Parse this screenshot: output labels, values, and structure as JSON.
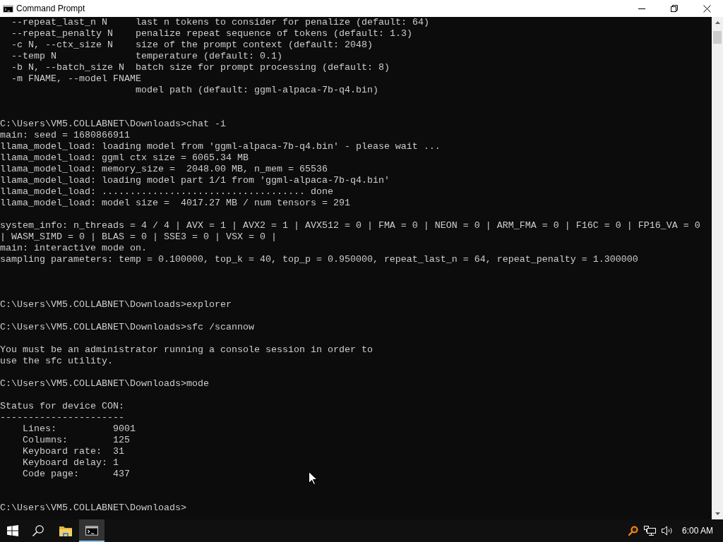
{
  "window": {
    "title": "Command Prompt"
  },
  "console": {
    "lines": [
      {
        "kind": "option",
        "flag": "--repeat_last_n N",
        "description": "last n tokens to consider for penalize (default: 64)"
      },
      {
        "kind": "option",
        "flag": "--repeat_penalty N",
        "description": "penalize repeat sequence of tokens (default: 1.3)"
      },
      {
        "kind": "option",
        "flag": "-c N, --ctx_size N",
        "description": "size of the prompt context (default: 2048)"
      },
      {
        "kind": "option",
        "flag": "--temp N",
        "description": "temperature (default: 0.1)"
      },
      {
        "kind": "option",
        "flag": "-b N, --batch_size N",
        "description": "batch size for prompt processing (default: 8)"
      },
      {
        "kind": "option",
        "flag": "-m FNAME, --model FNAME",
        "description": "model path (default: ggml-alpaca-7b-q4.bin)"
      },
      {
        "kind": "blank"
      },
      {
        "kind": "blank"
      },
      {
        "kind": "text",
        "text": "C:\\Users\\VM5.COLLABNET\\Downloads>chat -i"
      },
      {
        "kind": "text",
        "text": "main: seed = 1680866911"
      },
      {
        "kind": "text",
        "text": "llama_model_load: loading model from 'ggml-alpaca-7b-q4.bin' - please wait ..."
      },
      {
        "kind": "text",
        "text": "llama_model_load: ggml ctx size = 6065.34 MB"
      },
      {
        "kind": "text",
        "text": "llama_model_load: memory_size =  2048.00 MB, n_mem = 65536"
      },
      {
        "kind": "text",
        "text": "llama_model_load: loading model part 1/1 from 'ggml-alpaca-7b-q4.bin'"
      },
      {
        "kind": "text",
        "text": "llama_model_load: .................................... done"
      },
      {
        "kind": "text",
        "text": "llama_model_load: model size =  4017.27 MB / num tensors = 291"
      },
      {
        "kind": "blank"
      },
      {
        "kind": "text",
        "text": "system_info: n_threads = 4 / 4 | AVX = 1 | AVX2 = 1 | AVX512 = 0 | FMA = 0 | NEON = 0 | ARM_FMA = 0 | F16C = 0 | FP16_VA = 0"
      },
      {
        "kind": "text",
        "text": "| WASM_SIMD = 0 | BLAS = 0 | SSE3 = 0 | VSX = 0 |"
      },
      {
        "kind": "text",
        "text": "main: interactive mode on."
      },
      {
        "kind": "text",
        "text": "sampling parameters: temp = 0.100000, top_k = 40, top_p = 0.950000, repeat_last_n = 64, repeat_penalty = 1.300000"
      },
      {
        "kind": "blank"
      },
      {
        "kind": "blank"
      },
      {
        "kind": "blank"
      },
      {
        "kind": "text",
        "text": "C:\\Users\\VM5.COLLABNET\\Downloads>explorer"
      },
      {
        "kind": "blank"
      },
      {
        "kind": "text",
        "text": "C:\\Users\\VM5.COLLABNET\\Downloads>sfc /scannow"
      },
      {
        "kind": "blank"
      },
      {
        "kind": "text",
        "text": "You must be an administrator running a console session in order to"
      },
      {
        "kind": "text",
        "text": "use the sfc utility."
      },
      {
        "kind": "blank"
      },
      {
        "kind": "text",
        "text": "C:\\Users\\VM5.COLLABNET\\Downloads>mode"
      },
      {
        "kind": "blank"
      },
      {
        "kind": "text",
        "text": "Status for device CON:"
      },
      {
        "kind": "text",
        "text": "----------------------"
      },
      {
        "kind": "status",
        "label": "Lines:",
        "value": "9001"
      },
      {
        "kind": "status",
        "label": "Columns:",
        "value": "125"
      },
      {
        "kind": "status",
        "label": "Keyboard rate:",
        "value": "31"
      },
      {
        "kind": "status",
        "label": "Keyboard delay:",
        "value": "1"
      },
      {
        "kind": "status",
        "label": "Code page:",
        "value": "437"
      },
      {
        "kind": "blank"
      },
      {
        "kind": "blank"
      },
      {
        "kind": "text",
        "text": "C:\\Users\\VM5.COLLABNET\\Downloads>"
      }
    ]
  },
  "taskbar": {
    "apps": [
      {
        "kind": "folder",
        "selected": false
      },
      {
        "kind": "console",
        "selected": true
      }
    ],
    "clock": "6:00 AM"
  }
}
